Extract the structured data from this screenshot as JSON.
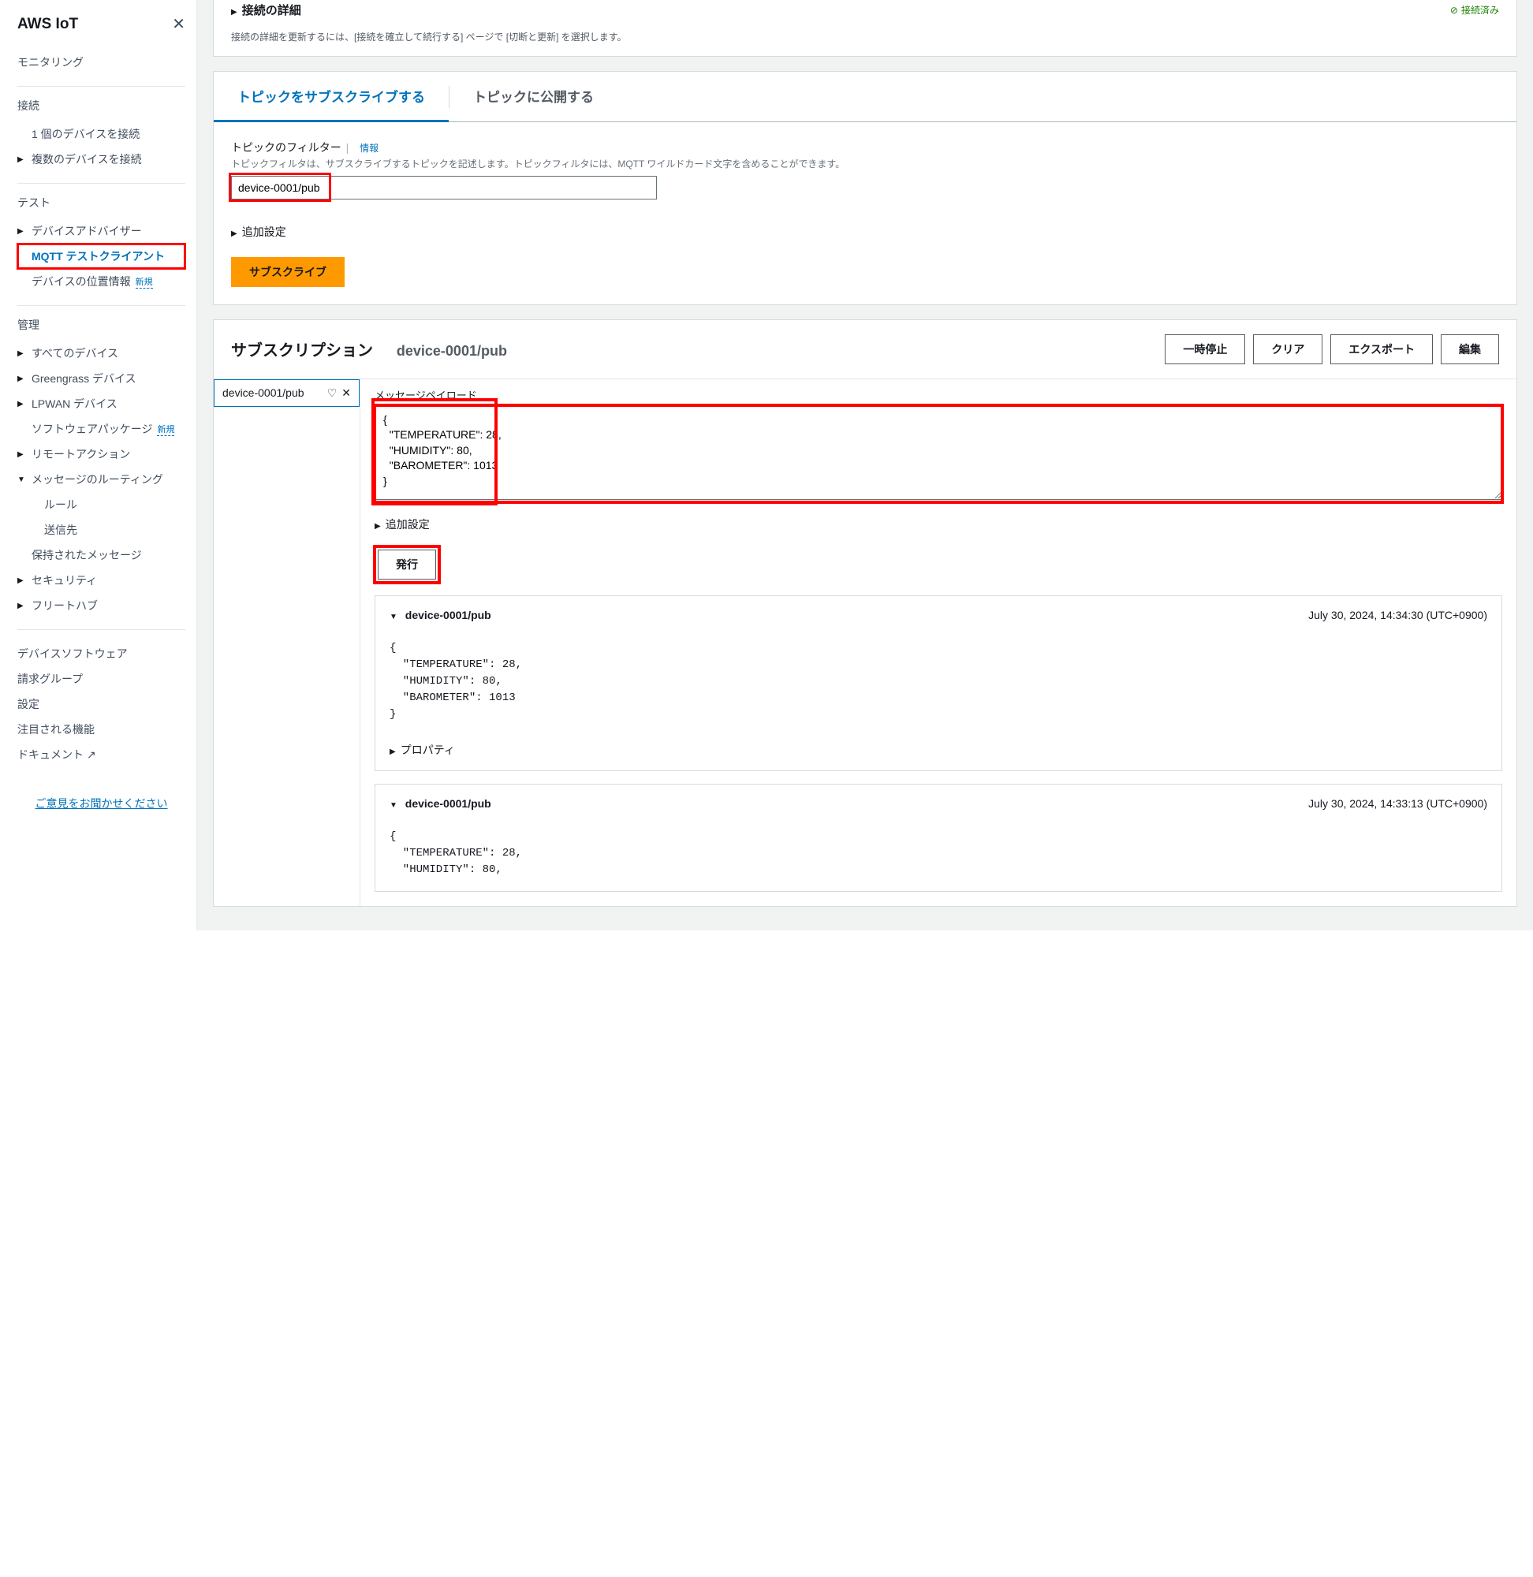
{
  "sidebar": {
    "title": "AWS IoT",
    "monitoring": "モニタリング",
    "connect": {
      "title": "接続",
      "one_device": "1 個のデバイスを接続",
      "many_devices": "複数のデバイスを接続"
    },
    "test": {
      "title": "テスト",
      "device_advisor": "デバイスアドバイザー",
      "mqtt_client": "MQTT テストクライアント",
      "device_location": "デバイスの位置情報",
      "new_badge": "新規"
    },
    "manage": {
      "title": "管理",
      "all_devices": "すべてのデバイス",
      "greengrass": "Greengrass デバイス",
      "lpwan": "LPWAN デバイス",
      "software_packages": "ソフトウェアパッケージ",
      "sp_new_badge": "新規",
      "remote_actions": "リモートアクション",
      "message_routing": "メッセージのルーティング",
      "rules": "ルール",
      "destinations": "送信先",
      "retained_messages": "保持されたメッセージ",
      "security": "セキュリティ",
      "fleet_hub": "フリートハブ"
    },
    "bottom": {
      "device_software": "デバイスソフトウェア",
      "billing_groups": "請求グループ",
      "settings": "設定",
      "featured": "注目される機能",
      "documentation": "ドキュメント"
    },
    "feedback": "ご意見をお聞かせください"
  },
  "connection": {
    "title": "接続の詳細",
    "status": "接続済み",
    "desc": "接続の詳細を更新するには、[接続を確立して続行する] ページで [切断と更新] を選択します。"
  },
  "tabs": {
    "subscribe": "トピックをサブスクライブする",
    "publish": "トピックに公開する"
  },
  "subscribe_form": {
    "filter_label": "トピックのフィルター",
    "info": "情報",
    "filter_desc": "トピックフィルタは、サブスクライブするトピックを記述します。トピックフィルタには、MQTT ワイルドカード文字を含めることができます。",
    "filter_value": "device-0001/pub",
    "additional": "追加設定",
    "subscribe_btn": "サブスクライブ"
  },
  "subscription": {
    "title": "サブスクリプション",
    "topic": "device-0001/pub",
    "pause": "一時停止",
    "clear": "クリア",
    "export": "エクスポート",
    "edit": "編集",
    "chip": "device-0001/pub",
    "payload_label": "メッセージペイロード",
    "payload_value": "{\n  \"TEMPERATURE\": 28,\n  \"HUMIDITY\": 80,\n  \"BAROMETER\": 1013\n}",
    "additional": "追加設定",
    "publish_btn": "発行",
    "properties": "プロパティ"
  },
  "messages": [
    {
      "topic": "device-0001/pub",
      "time": "July 30, 2024, 14:34:30 (UTC+0900)",
      "body": "{\n  \"TEMPERATURE\": 28,\n  \"HUMIDITY\": 80,\n  \"BAROMETER\": 1013\n}"
    },
    {
      "topic": "device-0001/pub",
      "time": "July 30, 2024, 14:33:13 (UTC+0900)",
      "body": "{\n  \"TEMPERATURE\": 28,\n  \"HUMIDITY\": 80,"
    }
  ]
}
